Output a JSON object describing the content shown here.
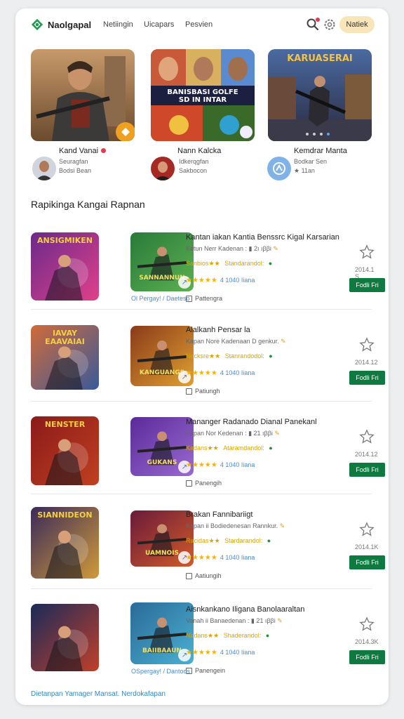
{
  "header": {
    "brand": "Naolgapal",
    "nav": [
      "Netiingin",
      "Uicapars",
      "Pesvien"
    ],
    "pill_label": "Natiek",
    "icons": [
      "logo-icon",
      "search-icon",
      "settings-icon"
    ]
  },
  "featured": [
    {
      "title": "Kand Vanai",
      "sub1": "Seuragfan",
      "sub2": "Bodsi Bean",
      "badge_icon": "bird-icon"
    },
    {
      "title": "Nann Kalcka",
      "sub1": "Idkerqgfan",
      "sub2": "Sakbocon",
      "overlay": "BANISBASI GOLFE\nSD IN INTAR"
    },
    {
      "title": "Kemdrar Manta",
      "sub1": "Bodkar Sen",
      "sub2": "★ 11an",
      "overlay": "KARUASERAI"
    }
  ],
  "section_title": "Rapikinga Kangai Rapnan",
  "apps": [
    {
      "thumb1_text": "ANSIGMIKEN",
      "thumb2_text": "SANNANNUN",
      "thumb_caption": "Ol Pergay! / Daeteso",
      "title": "Kantan iakan Kantia Benssrc Kigal Karsarian",
      "meta": "Ketun Nerr Kadenan : ▮ 2ı ıββi",
      "tag1": "Sanbios★★",
      "tag2": "Standarandol:",
      "rating": "★★★★★",
      "count": "4 1040 Iiana",
      "dev": "Pattengra",
      "date": "2014.1 S",
      "btn": "Fodli Fri"
    },
    {
      "thumb1_text": "IAVAY\nEAAVAIAI",
      "thumb2_text": "KANGUANGS",
      "thumb_caption": "",
      "title": "Alalkanh Pensar la",
      "meta": "Kapan Nore Kadenaan D genkur.",
      "tag1": "Nacksre★★",
      "tag2": "Stanrandodol:",
      "rating": "★★★★★",
      "count": "4 1040 Iiana",
      "dev": "Patiungh",
      "date": "2014.12",
      "btn": "Fodli Fri"
    },
    {
      "thumb1_text": "NENSTER",
      "thumb2_text": "GUKANS",
      "thumb_caption": "",
      "title": "Mananger Radanado Dianal Panekanl",
      "meta": "Kapan Nor Kedenan : ▮ 21 ıββi",
      "tag1": "Kadans★★",
      "tag2": "Ataramdandol:",
      "rating": "★★★★★",
      "count": "4 1040 Iiana",
      "dev": "Panengih",
      "date": "2014.12",
      "btn": "Fodli Fri"
    },
    {
      "thumb1_text": "SIANNIDEON",
      "thumb2_text": "UAMNOIS",
      "thumb_caption": "",
      "title": "Brakan Fannibariigt",
      "meta": "Kapan ii Bodiedenesan Rannkur.",
      "tag1": "Racidas★★",
      "tag2": "Stardarandol:",
      "rating": "★★★★★",
      "count": "4 1040 Iiana",
      "dev": "Aatiungih",
      "date": "2014.1K",
      "btn": "Fodli Fri"
    },
    {
      "thumb1_text": "",
      "thumb2_text": "BAIIBAAUN",
      "thumb_caption": "OSpergay! / Dantoos",
      "title": "Aisnkankano Iligana Banolaaraltan",
      "meta": "Vanah ii Banaedenan : ▮ 21 ıββi",
      "tag1": "Nadans★★",
      "tag2": "Shaderandol:",
      "rating": "★★★★★",
      "count": "4 1040 Iiana",
      "dev": "Panengein",
      "date": "2014.3K",
      "btn": "Fodli Fri"
    }
  ],
  "footer_link": "Dietanpan Yamager Mansat. Nerdokafapan",
  "colors": {
    "accent": "#0f7a3f",
    "pill": "#f9e6b8",
    "star": "#f5b400",
    "link": "#2d8ac8"
  }
}
